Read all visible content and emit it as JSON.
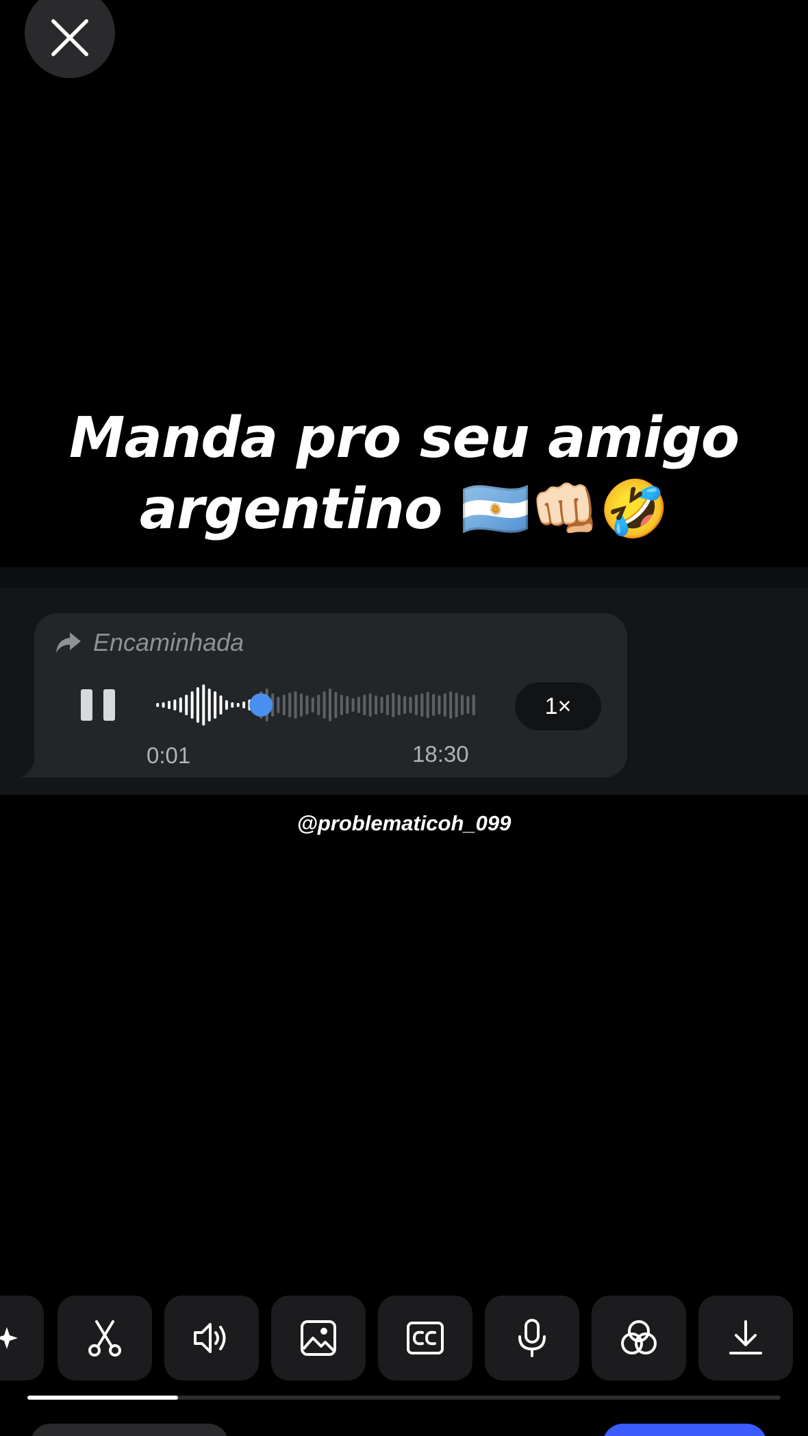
{
  "caption": {
    "line1": "Manda pro seu amigo",
    "line2": "argentino",
    "emojis": "🇦🇷👊🏻🤣"
  },
  "voice_message": {
    "forward_label": "Encaminhada",
    "elapsed_time": "0:01",
    "total_time": "18:30",
    "speed_label": "1×",
    "playback_progress": 0.33,
    "state": "playing"
  },
  "watermark": {
    "username": "@problematicoh_099"
  },
  "toolbar": {
    "tools": [
      {
        "icon": "sparkle-icon"
      },
      {
        "icon": "scissors-icon"
      },
      {
        "icon": "volume-icon"
      },
      {
        "icon": "image-icon"
      },
      {
        "icon": "captions-icon"
      },
      {
        "icon": "microphone-icon"
      },
      {
        "icon": "filters-icon"
      },
      {
        "icon": "download-icon"
      }
    ],
    "scroll_progress": 0.2
  },
  "colors": {
    "accent_blue": "#4a90f0",
    "bubble": "#232628",
    "tool_bg": "#1c1c1e",
    "primary_button": "#3b5bfd"
  }
}
